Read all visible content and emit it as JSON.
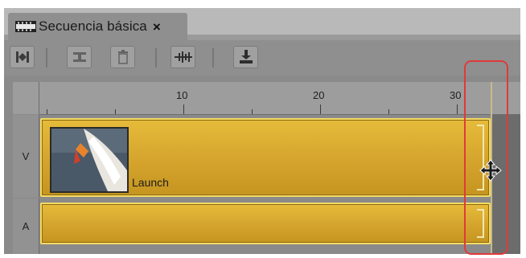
{
  "tab": {
    "title": "Secuencia básica",
    "close_glyph": "×"
  },
  "toolbar": {
    "buttons": [
      {
        "icon": "mark-in-out-icon"
      },
      {
        "icon": "lift-icon"
      },
      {
        "icon": "trash-icon"
      },
      {
        "icon": "snap-waveform-icon"
      },
      {
        "icon": "download-icon"
      }
    ]
  },
  "ruler": {
    "ticks": [
      "10",
      "20",
      "30"
    ]
  },
  "tracks": {
    "video": {
      "label": "V",
      "clip_name": "Launch"
    },
    "audio": {
      "label": "A"
    }
  },
  "colors": {
    "clip_fill": "#d8a82e",
    "clip_border": "#f5da63",
    "highlight": "#e03a3a",
    "panel": "#8f8f8f"
  }
}
